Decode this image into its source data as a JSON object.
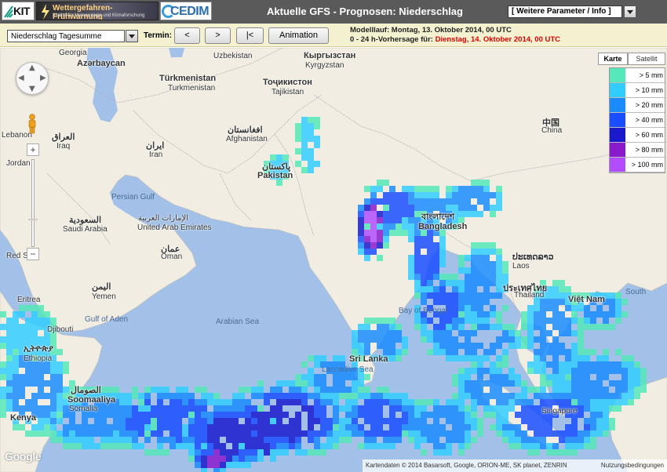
{
  "header": {
    "title": "Aktuelle GFS - Prognosen: Niederschlag",
    "logo_kit": "KIT",
    "logo_warn_title": "Wettergefahren-Frühwarnung",
    "logo_warn_sub": "Institut für Meteorologie und Klimaforschung",
    "logo_cedim": "CEDIM",
    "param_select": "[ Weitere Parameter / Info ]"
  },
  "toolbar": {
    "product_select": "Niederschlag Tagesumme",
    "termin_label": "Termin:",
    "prev_label": "<",
    "next_label": ">",
    "first_label": "|<",
    "animation_label": "Animation",
    "run_label": "Modelllauf: Montag, 13. Oktober 2014, 00 UTC",
    "forecast_prefix": "0 - 24 h-Vorhersage für:",
    "forecast_date": "Dienstag, 14. Oktober 2014, 00 UTC"
  },
  "map": {
    "type_karte": "Karte",
    "type_satellit": "Satellit",
    "google": "Google",
    "attribution": "Kartendaten © 2014 Basarsoft, Google, ORION-ME, SK planet, ZENRIN",
    "terms": "Nutzungsbedingungen",
    "zoom_in": "+",
    "zoom_out": "−",
    "labels": [
      {
        "text": "Georgia"
      },
      {
        "text": "Azərbaycan"
      },
      {
        "text": "Türkmenistan"
      },
      {
        "text": "Turkmenistan"
      },
      {
        "text": "Uzbekistan"
      },
      {
        "text": "Кыргызстан"
      },
      {
        "text": "Kyrgyzstan"
      },
      {
        "text": "Тоҷикистон"
      },
      {
        "text": "Tajikistan"
      },
      {
        "text": "العراق"
      },
      {
        "text": "Iraq"
      },
      {
        "text": "ایران"
      },
      {
        "text": "Iran"
      },
      {
        "text": "افغانستان"
      },
      {
        "text": "Afghanistan"
      },
      {
        "text": "پاکستان"
      },
      {
        "text": "Pakistan"
      },
      {
        "text": "中国"
      },
      {
        "text": "China"
      },
      {
        "text": "Jordan"
      },
      {
        "text": "السعودية"
      },
      {
        "text": "Saudi Arabia"
      },
      {
        "text": "الإمارات العربية"
      },
      {
        "text": "United Arab Emirates"
      },
      {
        "text": "عمان"
      },
      {
        "text": "Oman"
      },
      {
        "text": "اليمن"
      },
      {
        "text": "Yemen"
      },
      {
        "text": "Persian Gulf"
      },
      {
        "text": "Gulf of Aden"
      },
      {
        "text": "Arabian Sea"
      },
      {
        "text": "Bay of Bengal"
      },
      {
        "text": "Laccadive Sea"
      },
      {
        "text": "Sri Lanka"
      },
      {
        "text": "বাংলাদেশ"
      },
      {
        "text": "Bangladesh"
      },
      {
        "text": "ປະເທດລາວ"
      },
      {
        "text": "Laos"
      },
      {
        "text": "ประเทศไทย"
      },
      {
        "text": "Thailand"
      },
      {
        "text": "Việt Nam"
      },
      {
        "text": "South"
      },
      {
        "text": "Eritrea"
      },
      {
        "text": "Djibouti"
      },
      {
        "text": "ኢትዮጵያ"
      },
      {
        "text": "Ethiopia"
      },
      {
        "text": "الصومال"
      },
      {
        "text": "Soomaaliya"
      },
      {
        "text": "Somalia"
      },
      {
        "text": "Kenya"
      },
      {
        "text": "Singapore"
      },
      {
        "text": "Lebanon"
      },
      {
        "text": "Red Sea"
      }
    ]
  },
  "legend": [
    {
      "label": "> 5 mm",
      "color": "#55e8b8"
    },
    {
      "label": "> 10 mm",
      "color": "#33ccff"
    },
    {
      "label": "> 20 mm",
      "color": "#1a8cff"
    },
    {
      "label": "> 40 mm",
      "color": "#1a4dff"
    },
    {
      "label": "> 60 mm",
      "color": "#1a1acc"
    },
    {
      "label": "> 80 mm",
      "color": "#8a1acc"
    },
    {
      "label": "> 100 mm",
      "color": "#b24dff"
    }
  ],
  "colors": {
    "header_bg": "#5a5a5a",
    "toolbar_bg": "#f3f1cf",
    "water": "#a3c1e8",
    "land": "#f1ede2",
    "forecast_date": "#e00000"
  }
}
